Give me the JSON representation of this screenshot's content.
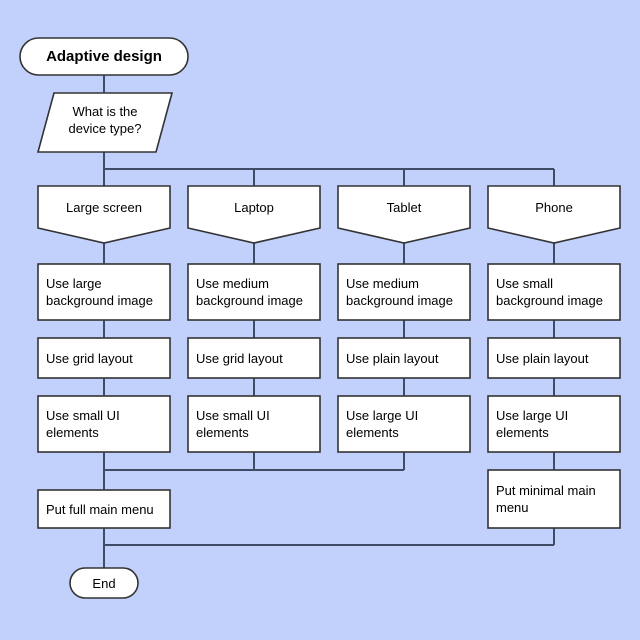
{
  "diagram": {
    "title": "Adaptive design",
    "background_color": "#c2d0fc",
    "node_fill_color": "#ffffff",
    "node_stroke_color": "#333333",
    "connector_color": "#404c66"
  },
  "nodes": {
    "start": {
      "label": "Adaptive design",
      "shape": "terminator"
    },
    "decision_input": {
      "label": "What is the\ndevice type?",
      "shape": "parallelogram"
    },
    "branches": [
      {
        "header": "Large screen",
        "shape": "manual-operation",
        "steps": [
          "Use large\nbackground image",
          "Use grid layout",
          "Use small UI\nelements"
        ]
      },
      {
        "header": "Laptop",
        "shape": "manual-operation",
        "steps": [
          "Use medium\nbackground image",
          "Use grid layout",
          "Use small UI\nelements"
        ]
      },
      {
        "header": "Tablet",
        "shape": "manual-operation",
        "steps": [
          "Use medium\nbackground image",
          "Use plain layout",
          "Use large UI\nelements"
        ]
      },
      {
        "header": "Phone",
        "shape": "manual-operation",
        "steps": [
          "Use small\nbackground image",
          "Use plain layout",
          "Use large UI\nelements"
        ]
      }
    ],
    "merge_left": {
      "label": "Put full main menu",
      "shape": "process"
    },
    "merge_right": {
      "label": "Put minimal main\nmenu",
      "shape": "process"
    },
    "end": {
      "label": "End",
      "shape": "terminator"
    }
  }
}
